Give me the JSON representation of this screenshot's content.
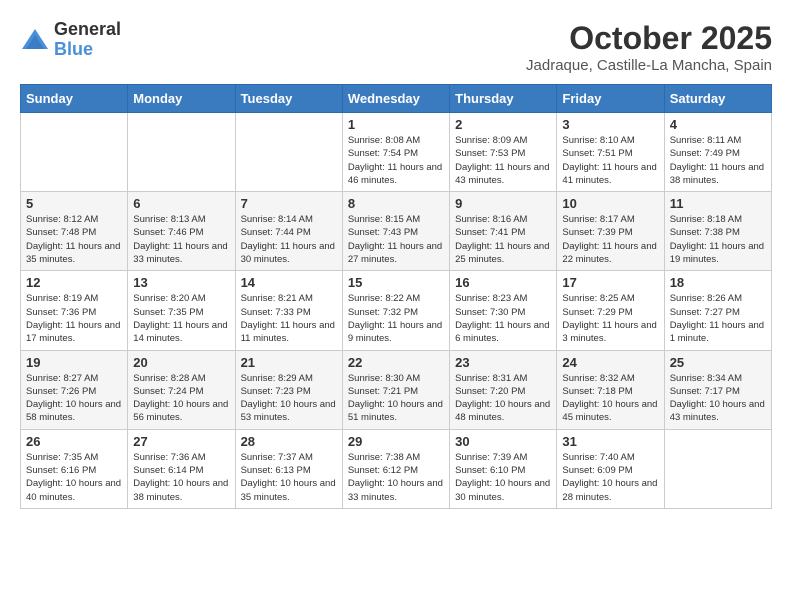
{
  "logo": {
    "general": "General",
    "blue": "Blue"
  },
  "title": {
    "month_year": "October 2025",
    "location": "Jadraque, Castille-La Mancha, Spain"
  },
  "weekdays": [
    "Sunday",
    "Monday",
    "Tuesday",
    "Wednesday",
    "Thursday",
    "Friday",
    "Saturday"
  ],
  "weeks": [
    [
      {
        "day": "",
        "info": ""
      },
      {
        "day": "",
        "info": ""
      },
      {
        "day": "",
        "info": ""
      },
      {
        "day": "1",
        "info": "Sunrise: 8:08 AM\nSunset: 7:54 PM\nDaylight: 11 hours and 46 minutes."
      },
      {
        "day": "2",
        "info": "Sunrise: 8:09 AM\nSunset: 7:53 PM\nDaylight: 11 hours and 43 minutes."
      },
      {
        "day": "3",
        "info": "Sunrise: 8:10 AM\nSunset: 7:51 PM\nDaylight: 11 hours and 41 minutes."
      },
      {
        "day": "4",
        "info": "Sunrise: 8:11 AM\nSunset: 7:49 PM\nDaylight: 11 hours and 38 minutes."
      }
    ],
    [
      {
        "day": "5",
        "info": "Sunrise: 8:12 AM\nSunset: 7:48 PM\nDaylight: 11 hours and 35 minutes."
      },
      {
        "day": "6",
        "info": "Sunrise: 8:13 AM\nSunset: 7:46 PM\nDaylight: 11 hours and 33 minutes."
      },
      {
        "day": "7",
        "info": "Sunrise: 8:14 AM\nSunset: 7:44 PM\nDaylight: 11 hours and 30 minutes."
      },
      {
        "day": "8",
        "info": "Sunrise: 8:15 AM\nSunset: 7:43 PM\nDaylight: 11 hours and 27 minutes."
      },
      {
        "day": "9",
        "info": "Sunrise: 8:16 AM\nSunset: 7:41 PM\nDaylight: 11 hours and 25 minutes."
      },
      {
        "day": "10",
        "info": "Sunrise: 8:17 AM\nSunset: 7:39 PM\nDaylight: 11 hours and 22 minutes."
      },
      {
        "day": "11",
        "info": "Sunrise: 8:18 AM\nSunset: 7:38 PM\nDaylight: 11 hours and 19 minutes."
      }
    ],
    [
      {
        "day": "12",
        "info": "Sunrise: 8:19 AM\nSunset: 7:36 PM\nDaylight: 11 hours and 17 minutes."
      },
      {
        "day": "13",
        "info": "Sunrise: 8:20 AM\nSunset: 7:35 PM\nDaylight: 11 hours and 14 minutes."
      },
      {
        "day": "14",
        "info": "Sunrise: 8:21 AM\nSunset: 7:33 PM\nDaylight: 11 hours and 11 minutes."
      },
      {
        "day": "15",
        "info": "Sunrise: 8:22 AM\nSunset: 7:32 PM\nDaylight: 11 hours and 9 minutes."
      },
      {
        "day": "16",
        "info": "Sunrise: 8:23 AM\nSunset: 7:30 PM\nDaylight: 11 hours and 6 minutes."
      },
      {
        "day": "17",
        "info": "Sunrise: 8:25 AM\nSunset: 7:29 PM\nDaylight: 11 hours and 3 minutes."
      },
      {
        "day": "18",
        "info": "Sunrise: 8:26 AM\nSunset: 7:27 PM\nDaylight: 11 hours and 1 minute."
      }
    ],
    [
      {
        "day": "19",
        "info": "Sunrise: 8:27 AM\nSunset: 7:26 PM\nDaylight: 10 hours and 58 minutes."
      },
      {
        "day": "20",
        "info": "Sunrise: 8:28 AM\nSunset: 7:24 PM\nDaylight: 10 hours and 56 minutes."
      },
      {
        "day": "21",
        "info": "Sunrise: 8:29 AM\nSunset: 7:23 PM\nDaylight: 10 hours and 53 minutes."
      },
      {
        "day": "22",
        "info": "Sunrise: 8:30 AM\nSunset: 7:21 PM\nDaylight: 10 hours and 51 minutes."
      },
      {
        "day": "23",
        "info": "Sunrise: 8:31 AM\nSunset: 7:20 PM\nDaylight: 10 hours and 48 minutes."
      },
      {
        "day": "24",
        "info": "Sunrise: 8:32 AM\nSunset: 7:18 PM\nDaylight: 10 hours and 45 minutes."
      },
      {
        "day": "25",
        "info": "Sunrise: 8:34 AM\nSunset: 7:17 PM\nDaylight: 10 hours and 43 minutes."
      }
    ],
    [
      {
        "day": "26",
        "info": "Sunrise: 7:35 AM\nSunset: 6:16 PM\nDaylight: 10 hours and 40 minutes."
      },
      {
        "day": "27",
        "info": "Sunrise: 7:36 AM\nSunset: 6:14 PM\nDaylight: 10 hours and 38 minutes."
      },
      {
        "day": "28",
        "info": "Sunrise: 7:37 AM\nSunset: 6:13 PM\nDaylight: 10 hours and 35 minutes."
      },
      {
        "day": "29",
        "info": "Sunrise: 7:38 AM\nSunset: 6:12 PM\nDaylight: 10 hours and 33 minutes."
      },
      {
        "day": "30",
        "info": "Sunrise: 7:39 AM\nSunset: 6:10 PM\nDaylight: 10 hours and 30 minutes."
      },
      {
        "day": "31",
        "info": "Sunrise: 7:40 AM\nSunset: 6:09 PM\nDaylight: 10 hours and 28 minutes."
      },
      {
        "day": "",
        "info": ""
      }
    ]
  ]
}
